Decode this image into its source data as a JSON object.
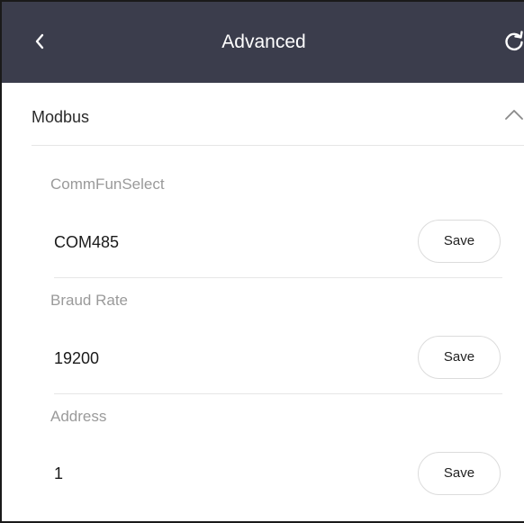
{
  "header": {
    "title": "Advanced",
    "back_icon": "chevron-left-icon",
    "refresh_icon": "refresh-icon",
    "background_color": "#3b3d4c"
  },
  "section": {
    "title": "Modbus",
    "expanded": true,
    "toggle_icon": "chevron-up-icon"
  },
  "fields": [
    {
      "label": "CommFunSelect",
      "value": "COM485",
      "save_label": "Save"
    },
    {
      "label": "Braud Rate",
      "value": "19200",
      "save_label": "Save"
    },
    {
      "label": "Address",
      "value": "1",
      "save_label": "Save"
    }
  ]
}
